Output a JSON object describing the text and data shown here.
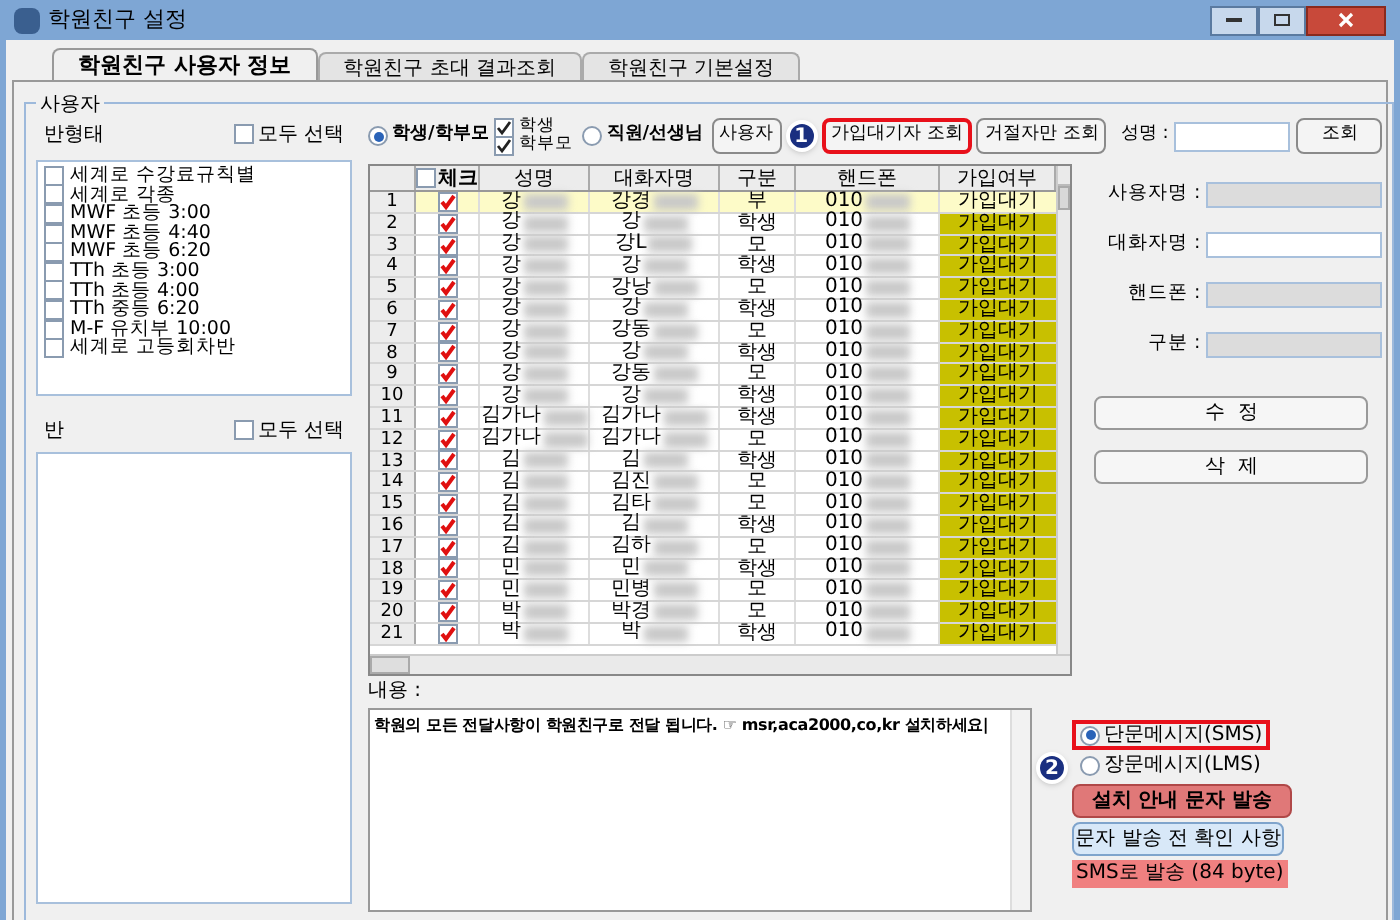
{
  "window": {
    "title": "학원친구 설정"
  },
  "tabs": [
    {
      "label": "학원친구 사용자 정보",
      "selected": true
    },
    {
      "label": "학원친구 초대 결과조회",
      "selected": false
    },
    {
      "label": "학원친구 기본설정",
      "selected": false
    }
  ],
  "group_title": "사용자",
  "class_types": {
    "label": "반형태",
    "select_all": {
      "label": "모두 선택",
      "checked": false
    },
    "items": [
      {
        "label": "세계로 수강료규칙별",
        "checked": false
      },
      {
        "label": "세계로 각종",
        "checked": false
      },
      {
        "label": "MWF 초등 3:00",
        "checked": false
      },
      {
        "label": "MWF 초등 4:40",
        "checked": false
      },
      {
        "label": "MWF 초등 6:20",
        "checked": false
      },
      {
        "label": "TTh 초등 3:00",
        "checked": false
      },
      {
        "label": "TTh 초등 4:00",
        "checked": false
      },
      {
        "label": "TTh 중등 6:20",
        "checked": false
      },
      {
        "label": "M-F 유치부 10:00",
        "checked": false
      },
      {
        "label": "세계로 고등회차반",
        "checked": false
      }
    ]
  },
  "classes": {
    "label": "반",
    "select_all": {
      "label": "모두 선택",
      "checked": false
    }
  },
  "filter_radios": [
    {
      "label": "학생/학부모",
      "selected": true
    },
    {
      "label": "직원/선생님",
      "selected": false
    }
  ],
  "filter_checks": [
    {
      "label": "학생",
      "checked": true
    },
    {
      "label": "학부모",
      "checked": true
    }
  ],
  "toolbar_buttons": [
    {
      "label": "사용자",
      "highlighted": false
    },
    {
      "label": "가입대기자 조회",
      "highlighted": true
    },
    {
      "label": "거절자만 조회",
      "highlighted": false
    }
  ],
  "name_search": {
    "label": "성명 :",
    "button": "조회"
  },
  "table": {
    "check_all": {
      "label": "체크",
      "checked": false
    },
    "columns": [
      "성명",
      "대화자명",
      "구분",
      "핸드폰",
      "가입여부"
    ],
    "rows": [
      {
        "index": "1",
        "checked": true,
        "selected": true,
        "name": "강",
        "nickname": "강경",
        "type": "부",
        "phone": "010",
        "status": "가입대기"
      },
      {
        "index": "2",
        "checked": true,
        "selected": false,
        "name": "강",
        "nickname": "강",
        "type": "학생",
        "phone": "010",
        "status": "가입대기"
      },
      {
        "index": "3",
        "checked": true,
        "selected": false,
        "name": "강",
        "nickname": "강L",
        "type": "모",
        "phone": "010",
        "status": "가입대기"
      },
      {
        "index": "4",
        "checked": true,
        "selected": false,
        "name": "강",
        "nickname": "강",
        "type": "학생",
        "phone": "010",
        "status": "가입대기"
      },
      {
        "index": "5",
        "checked": true,
        "selected": false,
        "name": "강",
        "nickname": "강낭",
        "type": "모",
        "phone": "010",
        "status": "가입대기"
      },
      {
        "index": "6",
        "checked": true,
        "selected": false,
        "name": "강",
        "nickname": "강",
        "type": "학생",
        "phone": "010",
        "status": "가입대기"
      },
      {
        "index": "7",
        "checked": true,
        "selected": false,
        "name": "강",
        "nickname": "강동",
        "type": "모",
        "phone": "010",
        "status": "가입대기"
      },
      {
        "index": "8",
        "checked": true,
        "selected": false,
        "name": "강",
        "nickname": "강",
        "type": "학생",
        "phone": "010",
        "status": "가입대기"
      },
      {
        "index": "9",
        "checked": true,
        "selected": false,
        "name": "강",
        "nickname": "강동",
        "type": "모",
        "phone": "010",
        "status": "가입대기"
      },
      {
        "index": "10",
        "checked": true,
        "selected": false,
        "name": "강",
        "nickname": "강",
        "type": "학생",
        "phone": "010",
        "status": "가입대기"
      },
      {
        "index": "11",
        "checked": true,
        "selected": false,
        "name": "김가나",
        "nickname": "김가나",
        "type": "학생",
        "phone": "010",
        "status": "가입대기"
      },
      {
        "index": "12",
        "checked": true,
        "selected": false,
        "name": "김가나",
        "nickname": "김가나",
        "type": "모",
        "phone": "010",
        "status": "가입대기"
      },
      {
        "index": "13",
        "checked": true,
        "selected": false,
        "name": "김",
        "nickname": "김",
        "type": "학생",
        "phone": "010",
        "status": "가입대기"
      },
      {
        "index": "14",
        "checked": true,
        "selected": false,
        "name": "김",
        "nickname": "김진",
        "type": "모",
        "phone": "010",
        "status": "가입대기"
      },
      {
        "index": "15",
        "checked": true,
        "selected": false,
        "name": "김",
        "nickname": "김타",
        "type": "모",
        "phone": "010",
        "status": "가입대기"
      },
      {
        "index": "16",
        "checked": true,
        "selected": false,
        "name": "김",
        "nickname": "김",
        "type": "학생",
        "phone": "010",
        "status": "가입대기"
      },
      {
        "index": "17",
        "checked": true,
        "selected": false,
        "name": "김",
        "nickname": "김하",
        "type": "모",
        "phone": "010",
        "status": "가입대기"
      },
      {
        "index": "18",
        "checked": true,
        "selected": false,
        "name": "민",
        "nickname": "민",
        "type": "학생",
        "phone": "010",
        "status": "가입대기"
      },
      {
        "index": "19",
        "checked": true,
        "selected": false,
        "name": "민",
        "nickname": "민병",
        "type": "모",
        "phone": "010",
        "status": "가입대기"
      },
      {
        "index": "20",
        "checked": true,
        "selected": false,
        "name": "박",
        "nickname": "박경",
        "type": "모",
        "phone": "010",
        "status": "가입대기"
      },
      {
        "index": "21",
        "checked": true,
        "selected": false,
        "name": "박",
        "nickname": "박",
        "type": "학생",
        "phone": "010",
        "status": "가입대기"
      }
    ]
  },
  "detail_fields": [
    {
      "label": "사용자명 :",
      "disabled": true
    },
    {
      "label": "대화자명 :",
      "disabled": false
    },
    {
      "label": "핸드폰 :",
      "disabled": true
    },
    {
      "label": "구분 :",
      "disabled": true
    }
  ],
  "detail_buttons": [
    "수  정",
    "삭  제"
  ],
  "content": {
    "label": "내용 :",
    "text": "학원의 모든 전달사항이 학원친구로 전달 됩니다. ☞ msr,aca2000,co,kr 설치하세요|"
  },
  "message_types": [
    {
      "label": "단문메시지(SMS)",
      "selected": true,
      "highlighted": true
    },
    {
      "label": "장문메시지(LMS)",
      "selected": false,
      "highlighted": false
    }
  ],
  "send_button": "설치 안내 문자 발송",
  "check_button": "문자 발송 전 확인 사항",
  "send_status": "SMS로 발송 (84 byte)",
  "annotations": [
    {
      "label": "1"
    },
    {
      "label": "2"
    }
  ]
}
